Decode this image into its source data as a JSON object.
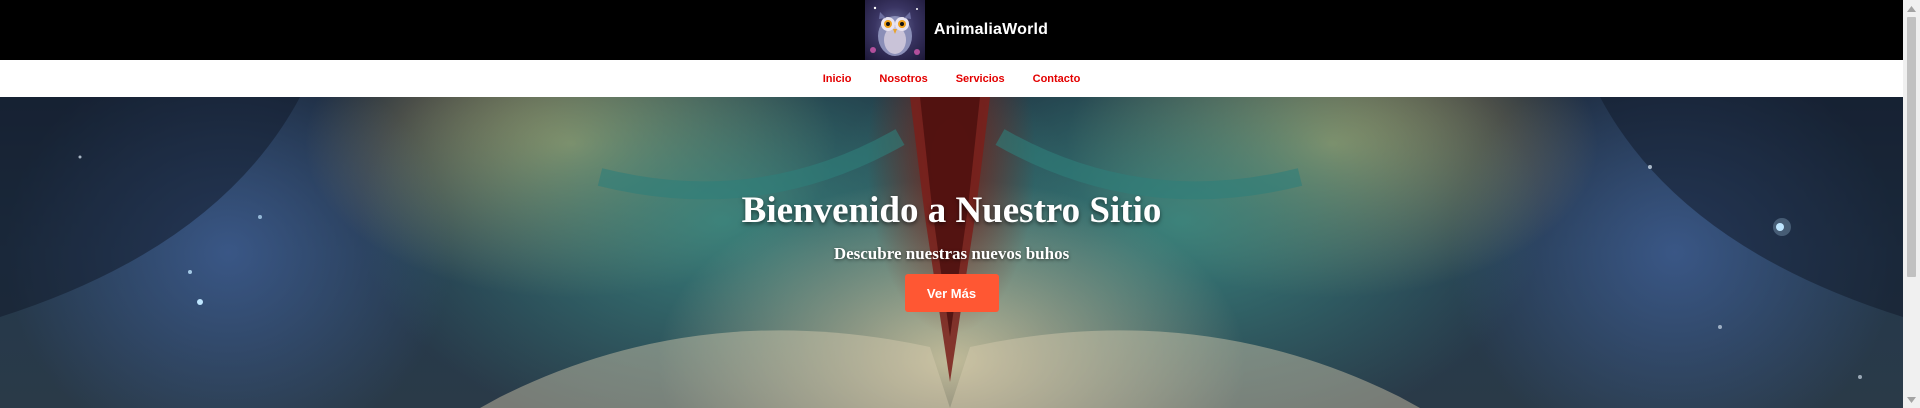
{
  "header": {
    "brand_name": "AnimaliaWorld",
    "logo_icon": "owl-logo-icon",
    "background": "#000000"
  },
  "nav": {
    "items": [
      {
        "label": "Inicio"
      },
      {
        "label": "Nosotros"
      },
      {
        "label": "Servicios"
      },
      {
        "label": "Contacto"
      }
    ],
    "link_color": "#e30000"
  },
  "hero": {
    "title": "Bienvenido a Nuestro Sitio",
    "subtitle": "Descubre nuestras nuevos buhos",
    "button_label": "Ver Más",
    "button_color": "#ff5733",
    "background": "painted owl artwork"
  },
  "scrollbar": {
    "up_icon": "arrow-up-icon",
    "down_icon": "arrow-down-icon"
  }
}
